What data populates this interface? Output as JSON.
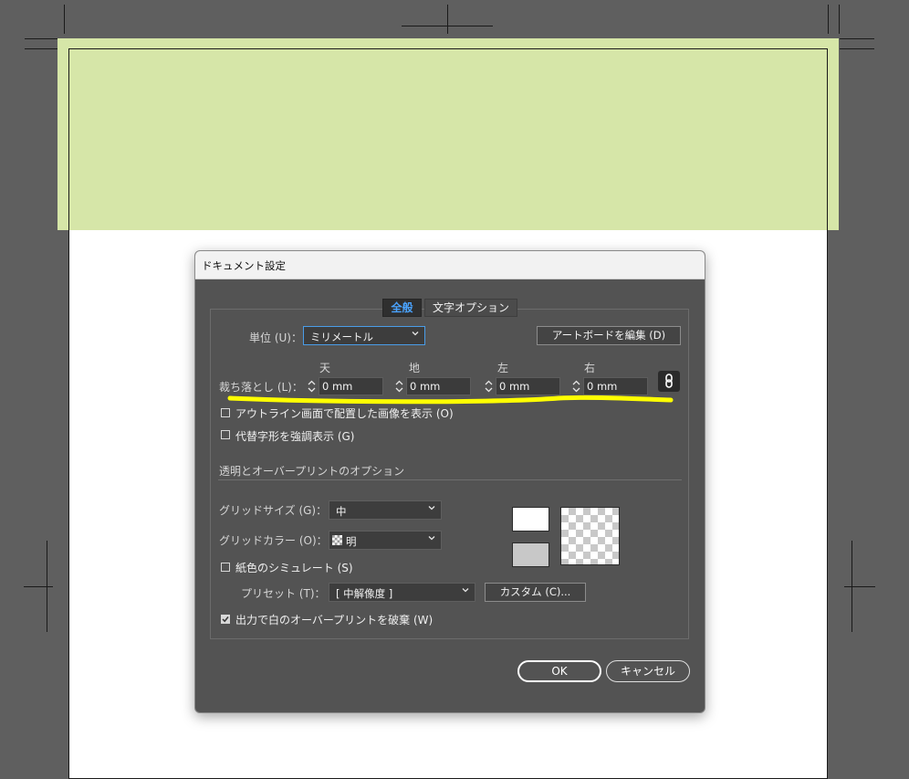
{
  "dialog": {
    "title": "ドキュメント設定",
    "tabs": [
      {
        "label": "全般",
        "active": true
      },
      {
        "label": "文字オプション",
        "active": false
      }
    ],
    "unit": {
      "label": "単位 (U)：",
      "value": "ミリメートル"
    },
    "edit_artboard_label": "アートボードを編集 (D)",
    "bleed": {
      "label": "裁ち落とし (L)：",
      "fields": [
        {
          "heading": "天",
          "value": "0 mm"
        },
        {
          "heading": "地",
          "value": "0 mm"
        },
        {
          "heading": "左",
          "value": "0 mm"
        },
        {
          "heading": "右",
          "value": "0 mm"
        }
      ],
      "link_icon": "chain-link-icon"
    },
    "options": [
      {
        "label": "アウトライン画面で配置した画像を表示 (O)",
        "checked": false
      },
      {
        "label": "代替字形を強調表示 (G)",
        "checked": false
      }
    ],
    "transparency": {
      "section_title": "透明とオーバープリントのオプション",
      "grid_size": {
        "label": "グリッドサイズ (G)：",
        "value": "中"
      },
      "grid_color": {
        "label": "グリッドカラー (O)：",
        "value": "明"
      },
      "simulate_paper": {
        "label": "紙色のシミュレート (S)",
        "checked": false
      },
      "preset": {
        "label": "プリセット (T)：",
        "value": "[ 中解像度 ]"
      },
      "custom_label": "カスタム (C)...",
      "discard_white": {
        "label": "出力で白のオーバープリントを破棄 (W)",
        "checked": true
      },
      "swatch_colors": {
        "top": "#ffffff",
        "bottom": "#c8c8c8"
      }
    },
    "ok_label": "OK",
    "cancel_label": "キャンセル"
  },
  "canvas": {
    "bleed_color": "#d6e6a8",
    "highlight_color": "#ffff00"
  }
}
